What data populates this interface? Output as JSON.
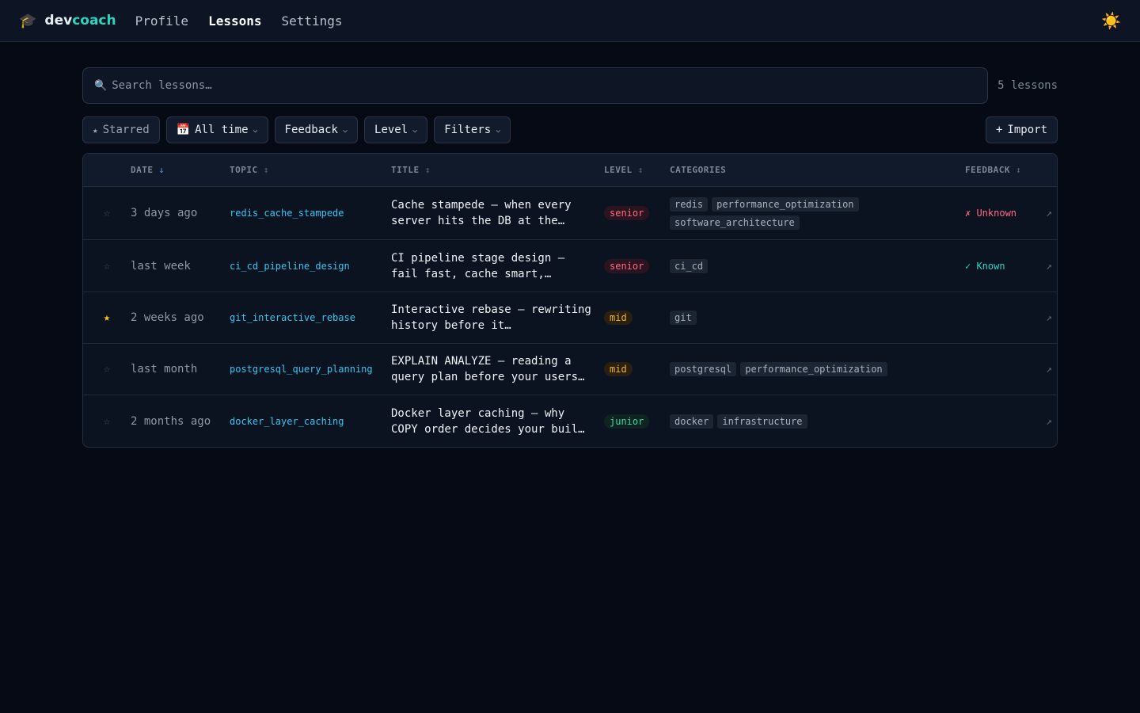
{
  "app": {
    "brand_icon": "graduation-cap-icon",
    "brand_dev": "dev",
    "brand_coach": "coach",
    "theme_icon": "sun-icon"
  },
  "nav": {
    "items": [
      {
        "label": "Profile",
        "active": false
      },
      {
        "label": "Lessons",
        "active": true
      },
      {
        "label": "Settings",
        "active": false
      }
    ]
  },
  "search": {
    "placeholder": "Search lessons…",
    "count": "5 lessons"
  },
  "filters": {
    "starred": "Starred",
    "time": "All time",
    "feedback": "Feedback",
    "level": "Level",
    "more": "Filters",
    "import": "Import"
  },
  "table": {
    "headers": {
      "date": "DATE",
      "topic": "TOPIC",
      "title": "TITLE",
      "level": "LEVEL",
      "categories": "CATEGORIES",
      "feedback": "FEEDBACK"
    },
    "rows": [
      {
        "starred": false,
        "date": "3 days ago",
        "topic": "redis_cache_stampede",
        "title": "Cache stampede — when every server hits the DB at the…",
        "level": "senior",
        "categories": [
          "redis",
          "performance_optimization",
          "software_architecture"
        ],
        "feedback": "✗ Unknown"
      },
      {
        "starred": false,
        "date": "last week",
        "topic": "ci_cd_pipeline_design",
        "title": "CI pipeline stage design — fail fast, cache smart,…",
        "level": "senior",
        "categories": [
          "ci_cd"
        ],
        "feedback": "✓ Known"
      },
      {
        "starred": true,
        "date": "2 weeks ago",
        "topic": "git_interactive_rebase",
        "title": "Interactive rebase — rewriting history before it…",
        "level": "mid",
        "categories": [
          "git"
        ],
        "feedback": ""
      },
      {
        "starred": false,
        "date": "last month",
        "topic": "postgresql_query_planning",
        "title": "EXPLAIN ANALYZE — reading a query plan before your users…",
        "level": "mid",
        "categories": [
          "postgresql",
          "performance_optimization"
        ],
        "feedback": ""
      },
      {
        "starred": false,
        "date": "2 months ago",
        "topic": "docker_layer_caching",
        "title": "Docker layer caching — why COPY order decides your buil…",
        "level": "junior",
        "categories": [
          "docker",
          "infrastructure"
        ],
        "feedback": ""
      }
    ]
  },
  "colors": {
    "accent": "#2fd4bf",
    "topic": "#36c6f0",
    "senior": "#ff6b7f",
    "mid": "#f3b33d",
    "junior": "#3dd6a3",
    "star_on": "#f5c518"
  }
}
